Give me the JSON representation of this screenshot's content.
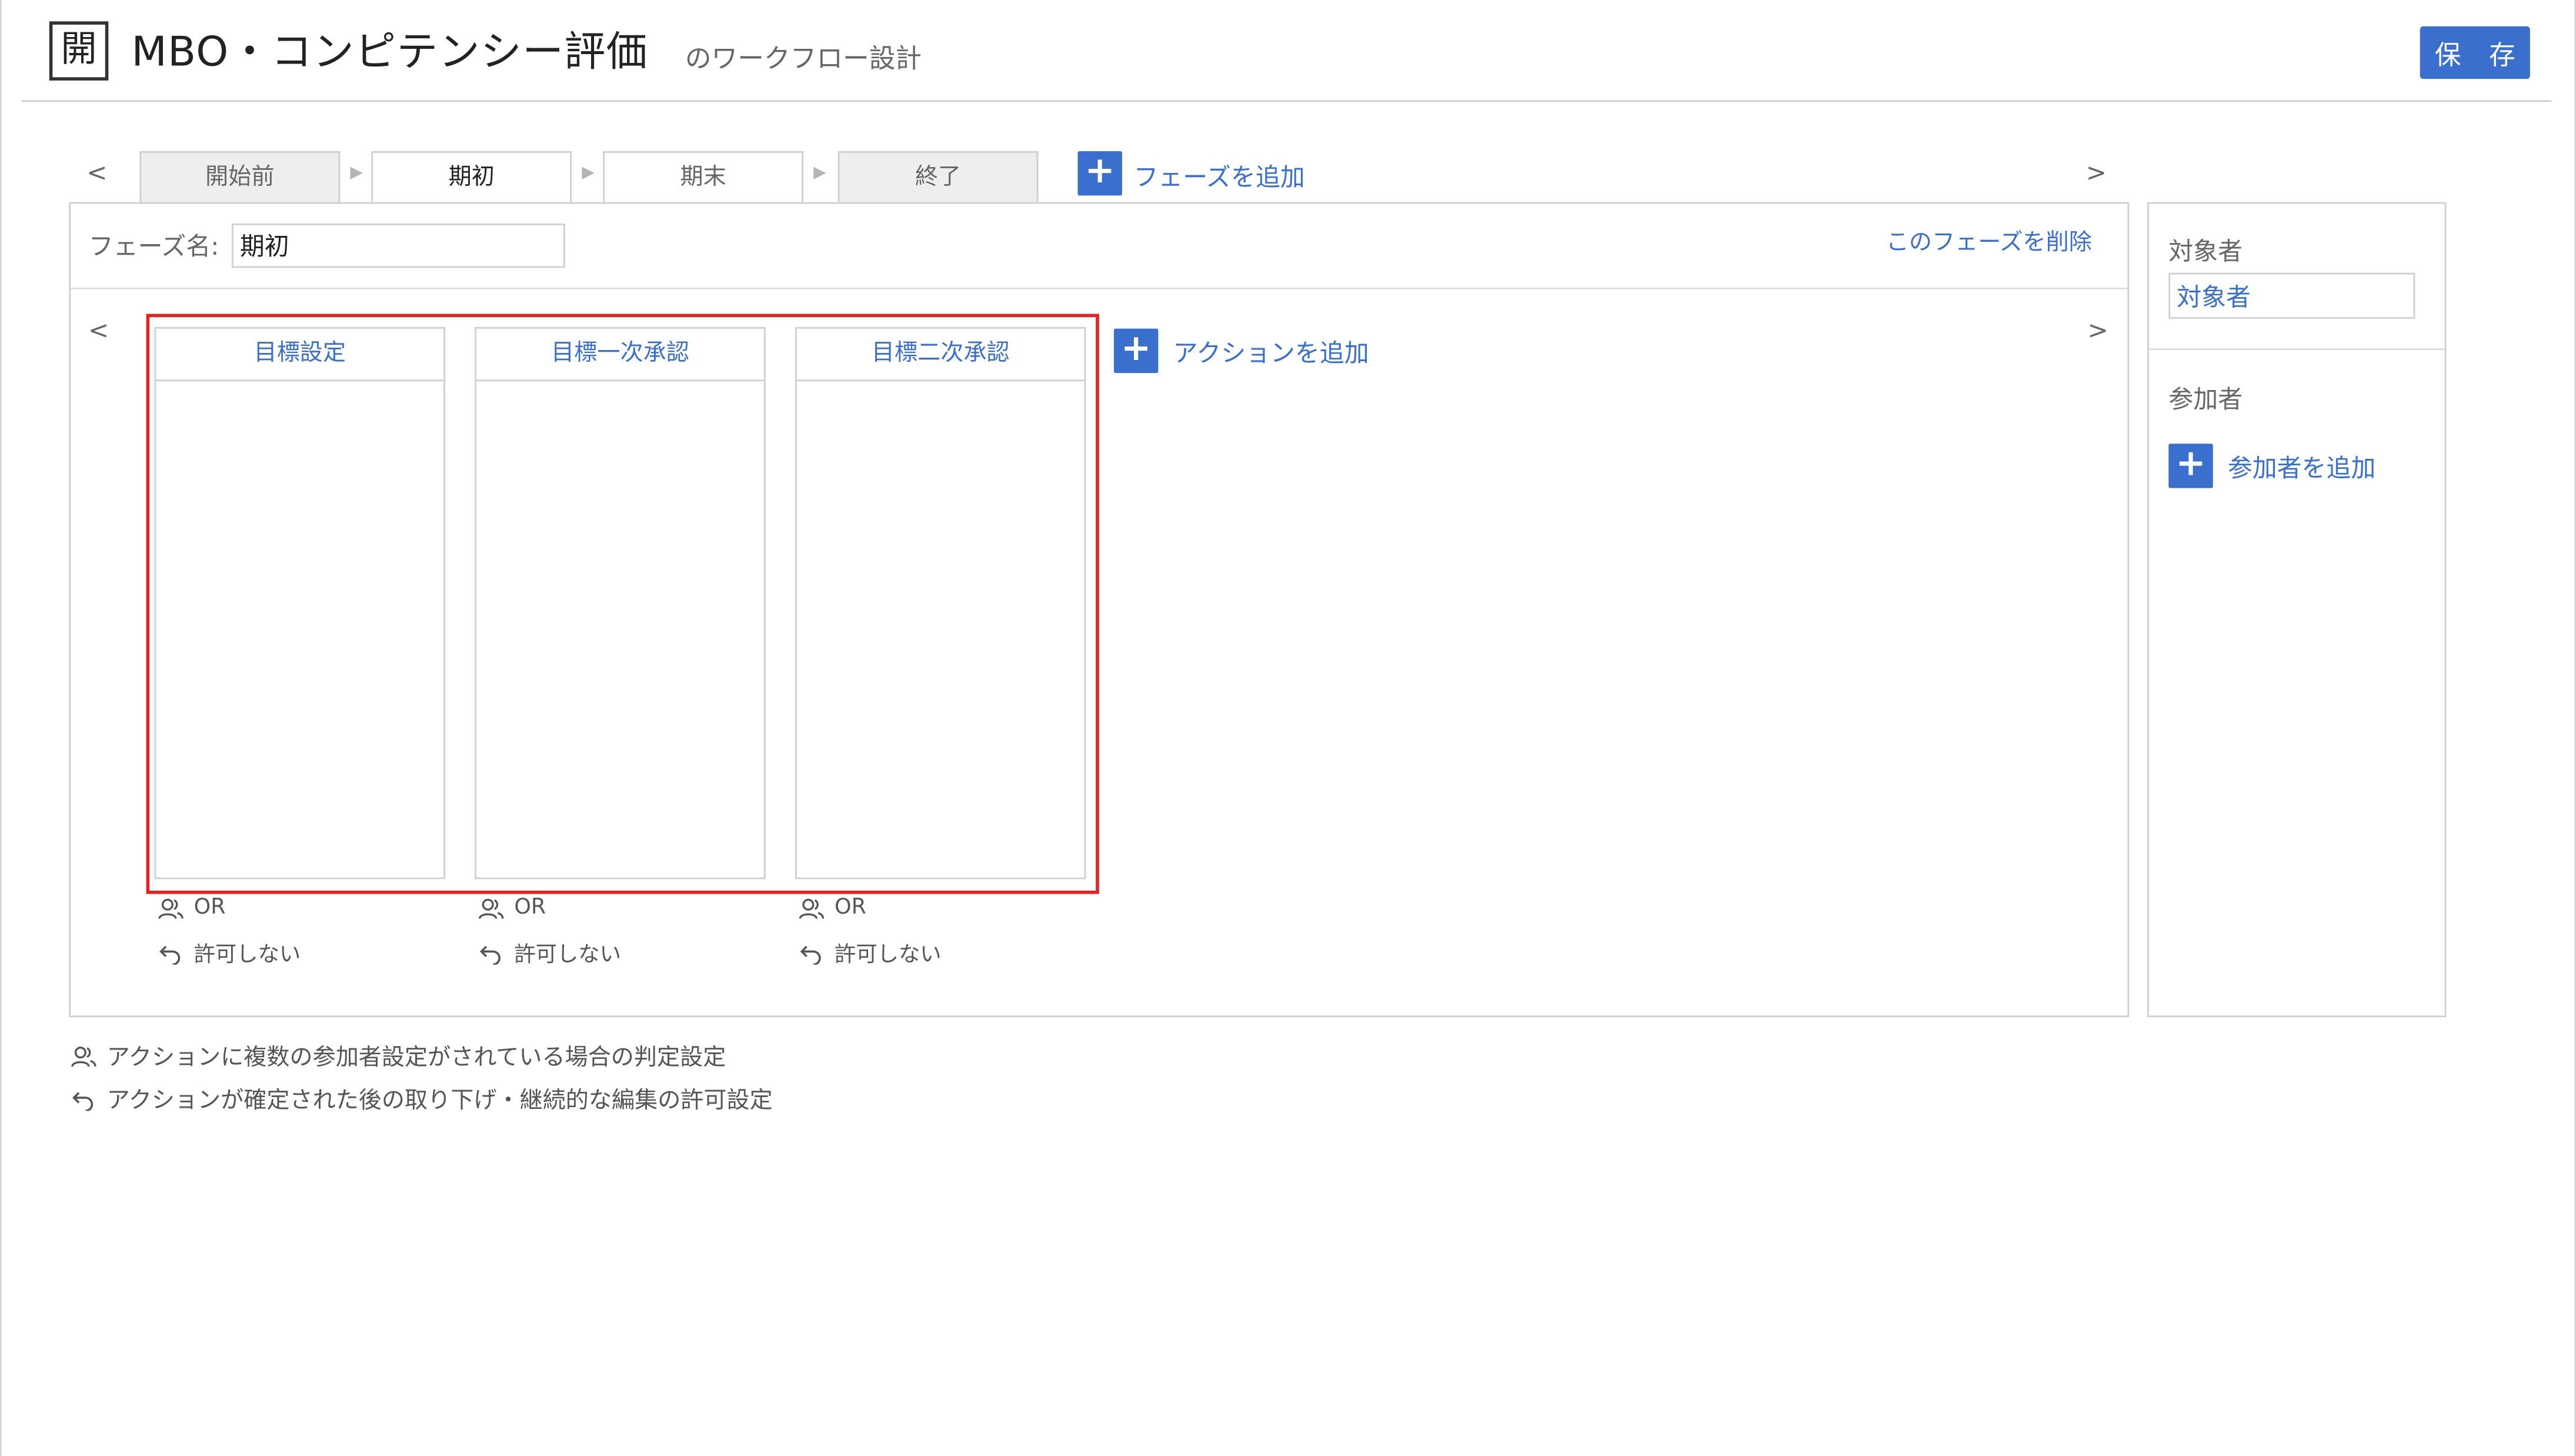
{
  "header": {
    "app_icon_char": "開",
    "title": "MBO・コンピテンシー評価",
    "subtitle": "のワークフロー設計",
    "save_label": "保 存"
  },
  "phases": {
    "prev_arrow": "<",
    "next_arrow": ">",
    "separator": "▶",
    "tabs": [
      {
        "label": "開始前",
        "active": false
      },
      {
        "label": "期初",
        "active": true
      },
      {
        "label": "期末",
        "active": false
      },
      {
        "label": "終了",
        "active": false
      }
    ],
    "add_icon": "+",
    "add_label": "フェーズを追加"
  },
  "phase_editor": {
    "name_label": "フェーズ名:",
    "name_value": "期初",
    "delete_label": "このフェーズを削除"
  },
  "actions": {
    "prev_arrow": "<",
    "next_arrow": ">",
    "add_icon": "+",
    "add_label": "アクションを追加",
    "cards": [
      {
        "title": "目標設定",
        "judgement": "OR",
        "revert": "許可しない"
      },
      {
        "title": "目標一次承認",
        "judgement": "OR",
        "revert": "許可しない"
      },
      {
        "title": "目標二次承認",
        "judgement": "OR",
        "revert": "許可しない"
      }
    ]
  },
  "side": {
    "target_label": "対象者",
    "target_value": "対象者",
    "participants_label": "参加者",
    "add_icon": "+",
    "add_participant_label": "参加者を追加"
  },
  "legend": {
    "judgement_text": "アクションに複数の参加者設定がされている場合の判定設定",
    "revert_text": "アクションが確定された後の取り下げ・継続的な編集の許可設定"
  },
  "colors": {
    "accent": "#3a6fcd",
    "highlight": "#e02424",
    "border": "#cfcfcf",
    "inactive_tab": "#eeeeee"
  },
  "icons": {
    "judgement": "users-icon",
    "revert": "undo-icon"
  }
}
